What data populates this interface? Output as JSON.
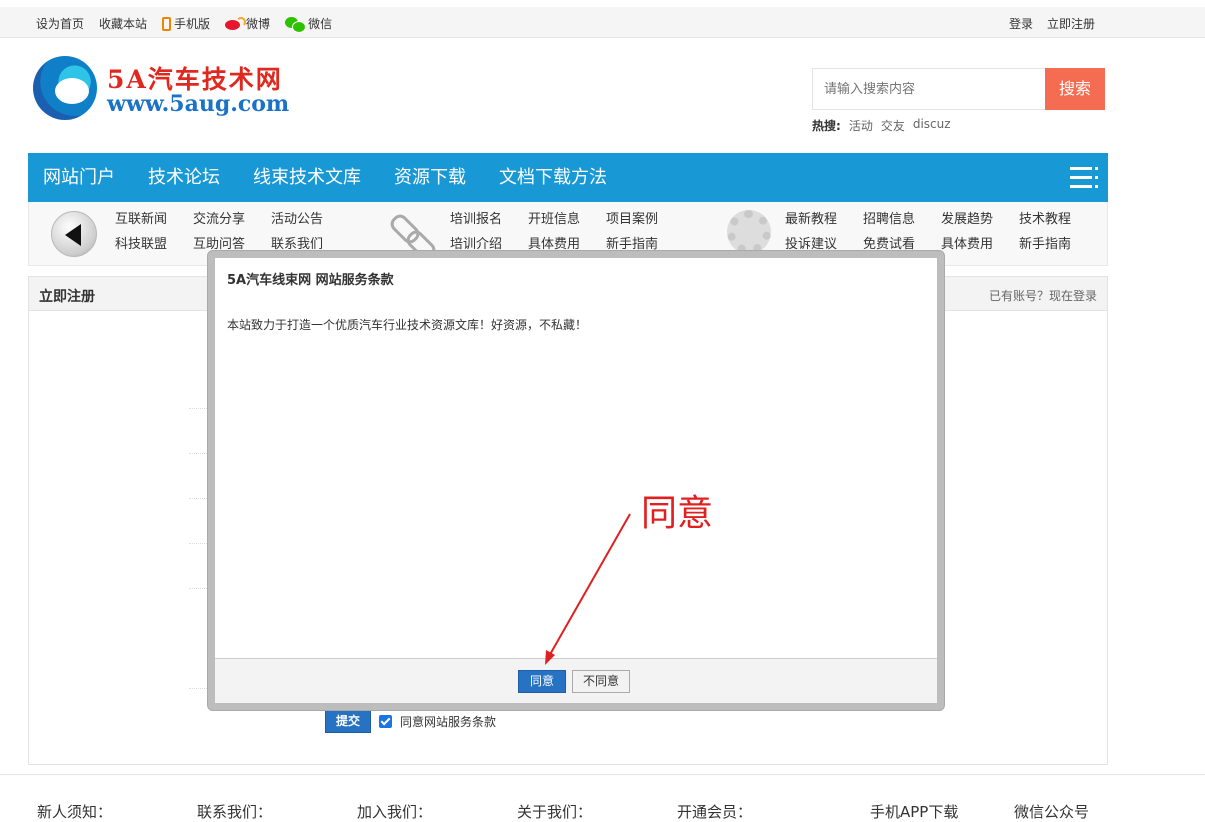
{
  "topbar": {
    "set_home": "设为首页",
    "bookmark": "收藏本站",
    "mobile": "手机版",
    "weibo": "微博",
    "wechat": "微信",
    "login": "登录",
    "register": "立即注册"
  },
  "logo": {
    "title": "5A汽车技术网",
    "url": "www.5aug.com"
  },
  "search": {
    "placeholder": "请输入搜索内容",
    "button": "搜索",
    "hot_label": "热搜:",
    "hot_terms": [
      "活动",
      "交友",
      "discuz"
    ]
  },
  "mainnav": {
    "items": [
      "网站门户",
      "技术论坛",
      "线束技术文库",
      "资源下载",
      "文档下载方法"
    ]
  },
  "subnav": {
    "group1": [
      "互联新闻",
      "交流分享",
      "活动公告",
      "科技联盟",
      "互助问答",
      "联系我们"
    ],
    "group2": [
      "培训报名",
      "开班信息",
      "项目案例",
      "培训介绍",
      "具体费用",
      "新手指南"
    ],
    "group3": [
      "最新教程",
      "招聘信息",
      "发展趋势",
      "技术教程",
      "投诉建议",
      "免费试看",
      "具体费用",
      "新手指南"
    ]
  },
  "panel": {
    "title": "立即注册",
    "login_link": "已有账号？现在登录",
    "submit": "提交",
    "agree_label": "同意网站服务条款"
  },
  "modal": {
    "title": "5A汽车线束网 网站服务条款",
    "body": "本站致力于打造一个优质汽车行业技术资源文库！好资源，不私藏！",
    "agree": "同意",
    "disagree": "不同意"
  },
  "annotation": {
    "text": "同意",
    "color": "#e02020"
  },
  "footer": {
    "items": [
      "新人须知：",
      "联系我们：",
      "加入我们：",
      "关于我们：",
      "开通会员：",
      "手机APP下载",
      "微信公众号"
    ]
  },
  "colors": {
    "nav_blue": "#1998d6",
    "search_orange": "#f46d52",
    "button_blue": "#2872c4"
  }
}
